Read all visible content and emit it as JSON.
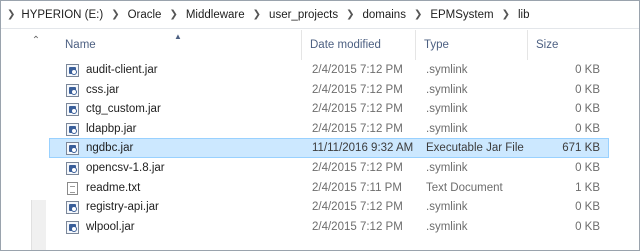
{
  "address_bar": {
    "crumbs": [
      "HYPERION (E:)",
      "Oracle",
      "Middleware",
      "user_projects",
      "domains",
      "EPMSystem",
      "lib"
    ]
  },
  "columns": {
    "name": "Name",
    "date": "Date modified",
    "type": "Type",
    "size": "Size"
  },
  "files": [
    {
      "name": "audit-client.jar",
      "date": "2/4/2015 7:12 PM",
      "type": ".symlink",
      "size": "0 KB",
      "icon": "jar-file-icon",
      "selected": false
    },
    {
      "name": "css.jar",
      "date": "2/4/2015 7:12 PM",
      "type": ".symlink",
      "size": "0 KB",
      "icon": "jar-file-icon",
      "selected": false
    },
    {
      "name": "ctg_custom.jar",
      "date": "2/4/2015 7:12 PM",
      "type": ".symlink",
      "size": "0 KB",
      "icon": "jar-file-icon",
      "selected": false
    },
    {
      "name": "ldapbp.jar",
      "date": "2/4/2015 7:12 PM",
      "type": ".symlink",
      "size": "0 KB",
      "icon": "jar-file-icon",
      "selected": false
    },
    {
      "name": "ngdbc.jar",
      "date": "11/11/2016 9:32 AM",
      "type": "Executable Jar File",
      "size": "671 KB",
      "icon": "jar-file-icon",
      "selected": true
    },
    {
      "name": "opencsv-1.8.jar",
      "date": "2/4/2015 7:12 PM",
      "type": ".symlink",
      "size": "0 KB",
      "icon": "jar-file-icon",
      "selected": false
    },
    {
      "name": "readme.txt",
      "date": "2/4/2015 7:11 PM",
      "type": "Text Document",
      "size": "1 KB",
      "icon": "text-file-icon",
      "selected": false
    },
    {
      "name": "registry-api.jar",
      "date": "2/4/2015 7:12 PM",
      "type": ".symlink",
      "size": "0 KB",
      "icon": "jar-file-icon",
      "selected": false
    },
    {
      "name": "wlpool.jar",
      "date": "2/4/2015 7:12 PM",
      "type": ".symlink",
      "size": "0 KB",
      "icon": "jar-file-icon",
      "selected": false
    }
  ],
  "colors": {
    "selection_bg": "#cce8ff",
    "selection_border": "#99d1ff",
    "header_text": "#4d6082"
  }
}
